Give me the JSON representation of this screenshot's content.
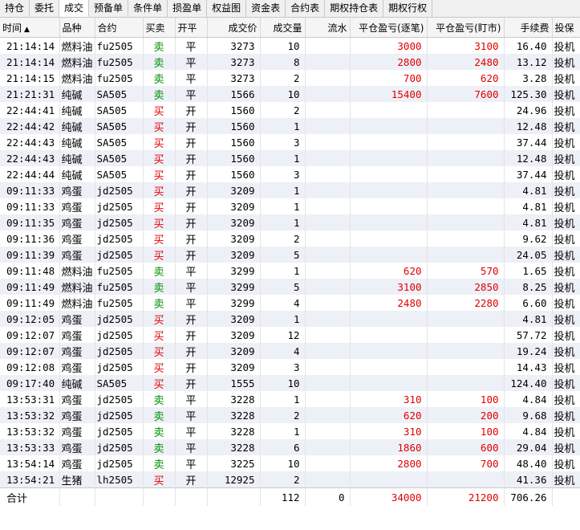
{
  "tabs": [
    {
      "label": "持仓",
      "active": false
    },
    {
      "label": "委托",
      "active": false
    },
    {
      "label": "成交",
      "active": true
    },
    {
      "label": "预备单",
      "active": false
    },
    {
      "label": "条件单",
      "active": false
    },
    {
      "label": "损盈单",
      "active": false
    },
    {
      "label": "权益图",
      "active": false
    },
    {
      "label": "资金表",
      "active": false
    },
    {
      "label": "合约表",
      "active": false
    },
    {
      "label": "期权持仓表",
      "active": false
    },
    {
      "label": "期权行权",
      "active": false
    }
  ],
  "columns": {
    "time": "时间",
    "sort_icon": "▲",
    "product": "品种",
    "contract": "合约",
    "side": "买卖",
    "openclose": "开平",
    "price": "成交价",
    "volume": "成交量",
    "flow": "流水",
    "pnl_trade": "平仓盈亏(逐笔)",
    "pnl_mark": "平仓盈亏(盯市)",
    "fee": "手续费",
    "hedge": "投保"
  },
  "colors": {
    "buy": "#e00000",
    "sell": "#009000",
    "pnl": "#e00000"
  },
  "rows": [
    {
      "time": "21:14:14",
      "product": "燃料油",
      "contract": "fu2505",
      "side": "卖",
      "openclose": "平",
      "price": "3273",
      "volume": "10",
      "flow": "",
      "pnl_trade": "3000",
      "pnl_mark": "3100",
      "fee": "16.40",
      "hedge": "投机"
    },
    {
      "time": "21:14:14",
      "product": "燃料油",
      "contract": "fu2505",
      "side": "卖",
      "openclose": "平",
      "price": "3273",
      "volume": "8",
      "flow": "",
      "pnl_trade": "2800",
      "pnl_mark": "2480",
      "fee": "13.12",
      "hedge": "投机"
    },
    {
      "time": "21:14:15",
      "product": "燃料油",
      "contract": "fu2505",
      "side": "卖",
      "openclose": "平",
      "price": "3273",
      "volume": "2",
      "flow": "",
      "pnl_trade": "700",
      "pnl_mark": "620",
      "fee": "3.28",
      "hedge": "投机"
    },
    {
      "time": "21:21:31",
      "product": "纯碱",
      "contract": "SA505",
      "side": "卖",
      "openclose": "平",
      "price": "1566",
      "volume": "10",
      "flow": "",
      "pnl_trade": "15400",
      "pnl_mark": "7600",
      "fee": "125.30",
      "hedge": "投机"
    },
    {
      "time": "22:44:41",
      "product": "纯碱",
      "contract": "SA505",
      "side": "买",
      "openclose": "开",
      "price": "1560",
      "volume": "2",
      "flow": "",
      "pnl_trade": "",
      "pnl_mark": "",
      "fee": "24.96",
      "hedge": "投机"
    },
    {
      "time": "22:44:42",
      "product": "纯碱",
      "contract": "SA505",
      "side": "买",
      "openclose": "开",
      "price": "1560",
      "volume": "1",
      "flow": "",
      "pnl_trade": "",
      "pnl_mark": "",
      "fee": "12.48",
      "hedge": "投机"
    },
    {
      "time": "22:44:43",
      "product": "纯碱",
      "contract": "SA505",
      "side": "买",
      "openclose": "开",
      "price": "1560",
      "volume": "3",
      "flow": "",
      "pnl_trade": "",
      "pnl_mark": "",
      "fee": "37.44",
      "hedge": "投机"
    },
    {
      "time": "22:44:43",
      "product": "纯碱",
      "contract": "SA505",
      "side": "买",
      "openclose": "开",
      "price": "1560",
      "volume": "1",
      "flow": "",
      "pnl_trade": "",
      "pnl_mark": "",
      "fee": "12.48",
      "hedge": "投机"
    },
    {
      "time": "22:44:44",
      "product": "纯碱",
      "contract": "SA505",
      "side": "买",
      "openclose": "开",
      "price": "1560",
      "volume": "3",
      "flow": "",
      "pnl_trade": "",
      "pnl_mark": "",
      "fee": "37.44",
      "hedge": "投机"
    },
    {
      "time": "09:11:33",
      "product": "鸡蛋",
      "contract": "jd2505",
      "side": "买",
      "openclose": "开",
      "price": "3209",
      "volume": "1",
      "flow": "",
      "pnl_trade": "",
      "pnl_mark": "",
      "fee": "4.81",
      "hedge": "投机"
    },
    {
      "time": "09:11:33",
      "product": "鸡蛋",
      "contract": "jd2505",
      "side": "买",
      "openclose": "开",
      "price": "3209",
      "volume": "1",
      "flow": "",
      "pnl_trade": "",
      "pnl_mark": "",
      "fee": "4.81",
      "hedge": "投机"
    },
    {
      "time": "09:11:35",
      "product": "鸡蛋",
      "contract": "jd2505",
      "side": "买",
      "openclose": "开",
      "price": "3209",
      "volume": "1",
      "flow": "",
      "pnl_trade": "",
      "pnl_mark": "",
      "fee": "4.81",
      "hedge": "投机"
    },
    {
      "time": "09:11:36",
      "product": "鸡蛋",
      "contract": "jd2505",
      "side": "买",
      "openclose": "开",
      "price": "3209",
      "volume": "2",
      "flow": "",
      "pnl_trade": "",
      "pnl_mark": "",
      "fee": "9.62",
      "hedge": "投机"
    },
    {
      "time": "09:11:39",
      "product": "鸡蛋",
      "contract": "jd2505",
      "side": "买",
      "openclose": "开",
      "price": "3209",
      "volume": "5",
      "flow": "",
      "pnl_trade": "",
      "pnl_mark": "",
      "fee": "24.05",
      "hedge": "投机"
    },
    {
      "time": "09:11:48",
      "product": "燃料油",
      "contract": "fu2505",
      "side": "卖",
      "openclose": "平",
      "price": "3299",
      "volume": "1",
      "flow": "",
      "pnl_trade": "620",
      "pnl_mark": "570",
      "fee": "1.65",
      "hedge": "投机"
    },
    {
      "time": "09:11:49",
      "product": "燃料油",
      "contract": "fu2505",
      "side": "卖",
      "openclose": "平",
      "price": "3299",
      "volume": "5",
      "flow": "",
      "pnl_trade": "3100",
      "pnl_mark": "2850",
      "fee": "8.25",
      "hedge": "投机"
    },
    {
      "time": "09:11:49",
      "product": "燃料油",
      "contract": "fu2505",
      "side": "卖",
      "openclose": "平",
      "price": "3299",
      "volume": "4",
      "flow": "",
      "pnl_trade": "2480",
      "pnl_mark": "2280",
      "fee": "6.60",
      "hedge": "投机"
    },
    {
      "time": "09:12:05",
      "product": "鸡蛋",
      "contract": "jd2505",
      "side": "买",
      "openclose": "开",
      "price": "3209",
      "volume": "1",
      "flow": "",
      "pnl_trade": "",
      "pnl_mark": "",
      "fee": "4.81",
      "hedge": "投机"
    },
    {
      "time": "09:12:07",
      "product": "鸡蛋",
      "contract": "jd2505",
      "side": "买",
      "openclose": "开",
      "price": "3209",
      "volume": "12",
      "flow": "",
      "pnl_trade": "",
      "pnl_mark": "",
      "fee": "57.72",
      "hedge": "投机"
    },
    {
      "time": "09:12:07",
      "product": "鸡蛋",
      "contract": "jd2505",
      "side": "买",
      "openclose": "开",
      "price": "3209",
      "volume": "4",
      "flow": "",
      "pnl_trade": "",
      "pnl_mark": "",
      "fee": "19.24",
      "hedge": "投机"
    },
    {
      "time": "09:12:08",
      "product": "鸡蛋",
      "contract": "jd2505",
      "side": "买",
      "openclose": "开",
      "price": "3209",
      "volume": "3",
      "flow": "",
      "pnl_trade": "",
      "pnl_mark": "",
      "fee": "14.43",
      "hedge": "投机"
    },
    {
      "time": "09:17:40",
      "product": "纯碱",
      "contract": "SA505",
      "side": "买",
      "openclose": "开",
      "price": "1555",
      "volume": "10",
      "flow": "",
      "pnl_trade": "",
      "pnl_mark": "",
      "fee": "124.40",
      "hedge": "投机"
    },
    {
      "time": "13:53:31",
      "product": "鸡蛋",
      "contract": "jd2505",
      "side": "卖",
      "openclose": "平",
      "price": "3228",
      "volume": "1",
      "flow": "",
      "pnl_trade": "310",
      "pnl_mark": "100",
      "fee": "4.84",
      "hedge": "投机"
    },
    {
      "time": "13:53:32",
      "product": "鸡蛋",
      "contract": "jd2505",
      "side": "卖",
      "openclose": "平",
      "price": "3228",
      "volume": "2",
      "flow": "",
      "pnl_trade": "620",
      "pnl_mark": "200",
      "fee": "9.68",
      "hedge": "投机"
    },
    {
      "time": "13:53:32",
      "product": "鸡蛋",
      "contract": "jd2505",
      "side": "卖",
      "openclose": "平",
      "price": "3228",
      "volume": "1",
      "flow": "",
      "pnl_trade": "310",
      "pnl_mark": "100",
      "fee": "4.84",
      "hedge": "投机"
    },
    {
      "time": "13:53:33",
      "product": "鸡蛋",
      "contract": "jd2505",
      "side": "卖",
      "openclose": "平",
      "price": "3228",
      "volume": "6",
      "flow": "",
      "pnl_trade": "1860",
      "pnl_mark": "600",
      "fee": "29.04",
      "hedge": "投机"
    },
    {
      "time": "13:54:14",
      "product": "鸡蛋",
      "contract": "jd2505",
      "side": "卖",
      "openclose": "平",
      "price": "3225",
      "volume": "10",
      "flow": "",
      "pnl_trade": "2800",
      "pnl_mark": "700",
      "fee": "48.40",
      "hedge": "投机"
    },
    {
      "time": "13:54:21",
      "product": "生猪",
      "contract": "lh2505",
      "side": "买",
      "openclose": "开",
      "price": "12925",
      "volume": "2",
      "flow": "",
      "pnl_trade": "",
      "pnl_mark": "",
      "fee": "41.36",
      "hedge": "投机"
    }
  ],
  "total": {
    "label": "合计",
    "volume": "112",
    "flow": "0",
    "pnl_trade": "34000",
    "pnl_mark": "21200",
    "fee": "706.26"
  }
}
